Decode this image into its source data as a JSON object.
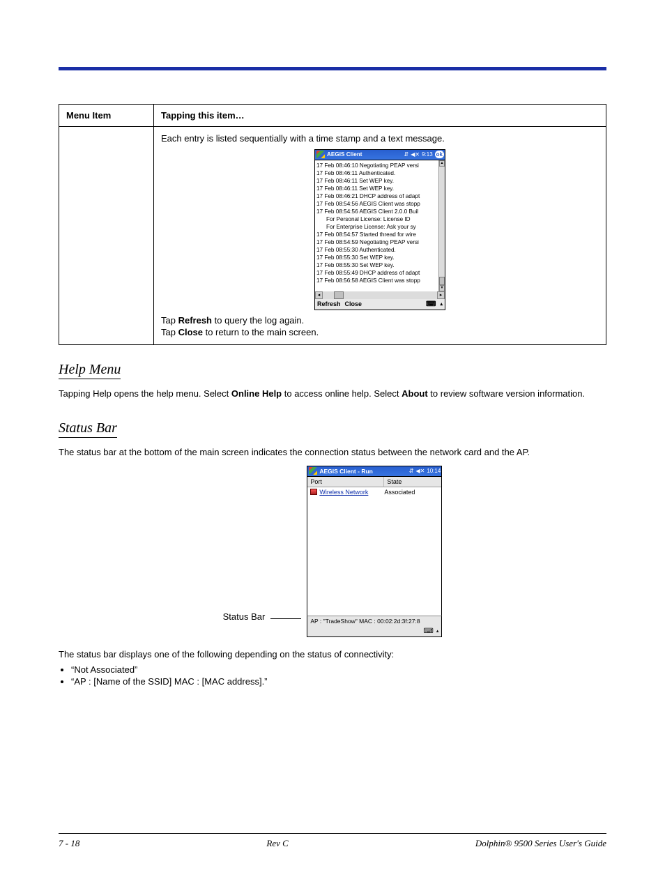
{
  "table": {
    "headers": {
      "col1": "Menu Item",
      "col2": "Tapping this item…"
    },
    "intro": "Each entry is listed sequentially with a time stamp and a text message.",
    "tap_refresh_pre": "Tap ",
    "tap_refresh_bold": "Refresh",
    "tap_refresh_post": " to query the log again.",
    "tap_close_pre": "Tap ",
    "tap_close_bold": "Close",
    "tap_close_post": " to return to the main screen."
  },
  "pda1": {
    "title": "AEGIS Client",
    "time": "9:13",
    "ok": "ok",
    "menu": {
      "refresh": "Refresh",
      "close": "Close"
    },
    "log": [
      "17 Feb 08:46:10 Negotiating PEAP versi",
      "17 Feb 08:46:11 Authenticated.",
      "17 Feb 08:46:11 Set WEP key.",
      "17 Feb 08:46:11 Set WEP key.",
      "17 Feb 08:46:21 DHCP address of adapt",
      "17 Feb 08:54:56 AEGIS Client was stopp",
      "17 Feb 08:54:56 AEGIS Client 2.0.0 Buil",
      "For Personal License:    License ID",
      "For Enterprise License:   Ask your sy",
      "17 Feb 08:54:57 Started thread for wire",
      "17 Feb 08:54:59 Negotiating PEAP versi",
      "17 Feb 08:55:30 Authenticated.",
      "17 Feb 08:55:30 Set WEP key.",
      "17 Feb 08:55:30 Set WEP key.",
      "17 Feb 08:55:49 DHCP address of adapt",
      "17 Feb 08:56:58 AEGIS Client was stopp"
    ],
    "indented_lines": [
      7,
      8
    ]
  },
  "help_menu": {
    "heading": "Help Menu",
    "text_pre": "Tapping Help opens the help menu. Select ",
    "online_help": "Online Help",
    "text_mid": " to access online help. Select ",
    "about": "About",
    "text_post": " to review software version information."
  },
  "status_bar_section": {
    "heading": "Status Bar",
    "intro": "The status bar at the bottom of the main screen indicates the connection status between the network card and the AP.",
    "callout_label": "Status Bar",
    "outro": "The status bar displays one of the following depending on the status of connectivity:",
    "bullets": [
      "“Not Associated”",
      "“AP : [Name of the SSID] MAC : [MAC address].”"
    ]
  },
  "pda2": {
    "title": "AEGIS Client - Run",
    "time": "10:14",
    "columns": {
      "port": "Port",
      "state": "State"
    },
    "row": {
      "port": "Wireless Network",
      "state": "Associated"
    },
    "status": "AP : \"TradeShow\" MAC : 00:02:2d:3f:27:8"
  },
  "footer": {
    "left": "7 - 18",
    "center": "Rev C",
    "right": "Dolphin® 9500 Series User's Guide"
  }
}
